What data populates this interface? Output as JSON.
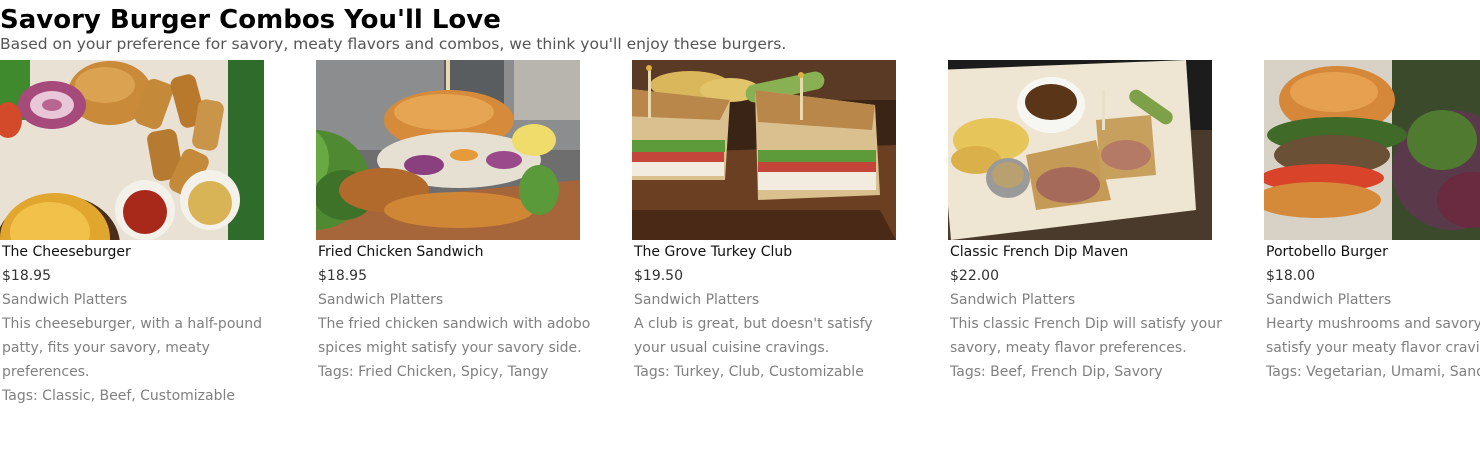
{
  "header": {
    "title": "Savory Burger Combos You'll Love",
    "subtitle": "Based on your preference for savory, meaty flavors and combos, we think you'll enjoy these burgers."
  },
  "tags_prefix": "Tags: ",
  "items": [
    {
      "name": "The Cheeseburger",
      "price": "$18.95",
      "category": "Sandwich Platters",
      "description": "This cheeseburger, with a half-pound patty, fits your savory, meaty preferences.",
      "tags": "Classic, Beef, Customizable"
    },
    {
      "name": "Fried Chicken Sandwich",
      "price": "$18.95",
      "category": "Sandwich Platters",
      "description": "The fried chicken sandwich with adobo spices might satisfy your savory side.",
      "tags": "Fried Chicken, Spicy, Tangy"
    },
    {
      "name": "The Grove Turkey Club",
      "price": "$19.50",
      "category": "Sandwich Platters",
      "description": "A club is great, but doesn't satisfy your usual cuisine cravings.",
      "tags": "Turkey, Club, Customizable"
    },
    {
      "name": "Classic French Dip Maven",
      "price": "$22.00",
      "category": "Sandwich Platters",
      "description": "This classic French Dip will satisfy your savory, meaty flavor preferences.",
      "tags": "Beef, French Dip, Savory"
    },
    {
      "name": "Portobello Burger",
      "price": "$18.00",
      "category": "Sandwich Platters",
      "description": "Hearty mushrooms and savory toppings satisfy your meaty flavor cravings.",
      "tags": "Vegetarian, Umami, Sandwich"
    }
  ]
}
